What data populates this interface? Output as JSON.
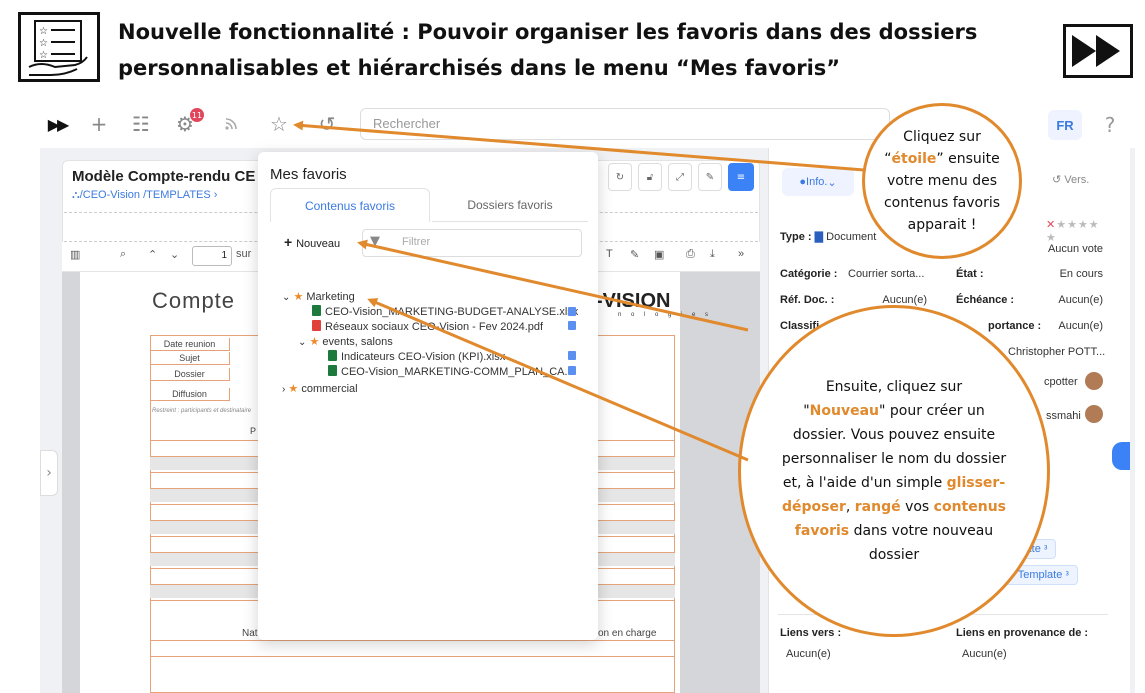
{
  "banner": {
    "title": "Nouvelle fonctionnalité : Pouvoir organiser les favoris dans des dossiers personnalisables et hiérarchisés dans le menu “Mes favoris”",
    "left_icon": "checklist-hand-icon",
    "right_icon": "fast-forward-icon"
  },
  "toolbar": {
    "icons": [
      "fast-forward-icon",
      "plus-icon",
      "tree-list-icon",
      "cogs-icon",
      "rss-icon",
      "star-icon",
      "history-icon"
    ],
    "notification_badge": "11",
    "search_placeholder": "Rechercher",
    "lang": "FR",
    "help": "?"
  },
  "document": {
    "title": "Modèle Compte-rendu CE",
    "path": "/CEO-Vision /TEMPLATES",
    "page_value": "1",
    "page_of": "sur",
    "heading": "Compte",
    "logo": "-VISION",
    "logo_sub": "n o l o g i e s",
    "form_labels": [
      "Date reunion",
      "Sujet",
      "Dossier",
      "Diffusion"
    ],
    "form_note": "Restreint : participants et destinataire",
    "p_label": "P",
    "nat_label": "Nat",
    "charge_label": "on en charge"
  },
  "favorites": {
    "title": "Mes favoris",
    "tab_contents": "Contenus favoris",
    "tab_folders": "Dossiers favoris",
    "new_label": "Nouveau",
    "filter_placeholder": "Filtrer",
    "tree": {
      "marketing": "Marketing",
      "file1": "CEO-Vision_MARKETING-BUDGET-ANALYSE.xlsx",
      "file2": "Réseaux sociaux CEO-Vision - Fev 2024.pdf",
      "events": "events, salons",
      "file3": "Indicateurs CEO-Vision (KPI).xlsx",
      "file4": "CEO-Vision_MARKETING-COMM_PLAN_CA...",
      "commercial": "commercial"
    }
  },
  "info": {
    "tab_info": "Info.",
    "tab_vers": "Vers.",
    "type_label": "Type :",
    "type_value": "Document",
    "votes": "Aucun vote",
    "categorie_label": "Catégorie :",
    "categorie_value": "Courrier sorta...",
    "etat_label": "État :",
    "etat_value": "En cours",
    "ref_label": "Réf. Doc. :",
    "ref_value": "Aucun(e)",
    "echeance_label": "Échéance :",
    "echeance_value": "Aucun(e)",
    "classif_label": "Classifi",
    "importance_label": "portance :",
    "importance_value": "Aucun(e)",
    "owner": "Christopher POTT...",
    "user1": "cpotter",
    "user2": "ssmahi",
    "tag1": "plate",
    "tag2": "Template",
    "liens_vers_label": "Liens vers :",
    "liens_vers_value": "Aucun(e)",
    "liens_prov_label": "Liens en provenance de :",
    "liens_prov_value": "Aucun(e)"
  },
  "callouts": {
    "c1_a": "Cliquez sur",
    "c1_hl": "étoile",
    "c1_b": "ensuite votre menu des contenus favoris apparait !",
    "c2_a": "Ensuite, cliquez sur",
    "c2_hl1": "Nouveau",
    "c2_b": "pour créer un dossier. Vous pouvez ensuite personnaliser le nom du dossier et, à l'aide d'un simple",
    "c2_hl2": "glisser-déposer",
    "c2_hl3": "rangé",
    "c2_c": "vos",
    "c2_hl4": "contenus favoris",
    "c2_d": "dans votre nouveau dossier"
  },
  "colors": {
    "accent": "#e0892d",
    "blue": "#3b7ae0",
    "star": "#ef8a2a"
  }
}
